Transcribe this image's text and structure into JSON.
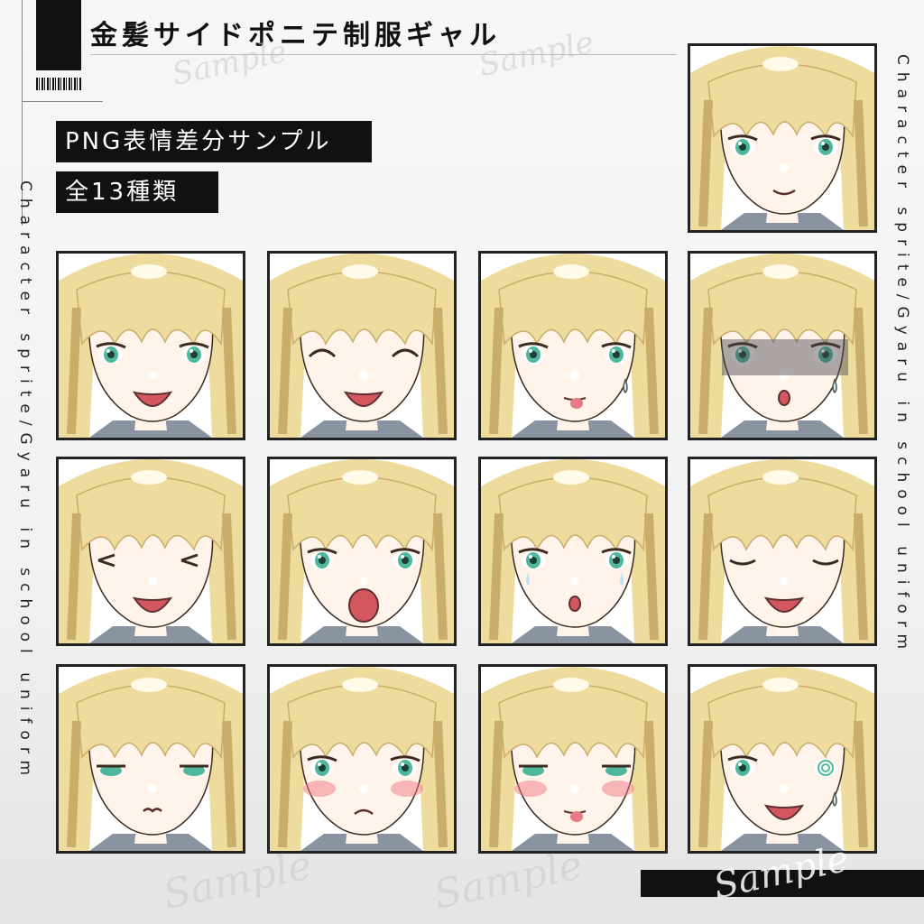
{
  "header": {
    "title": "金髪サイドポニテ制服ギャル",
    "tag_line1": "PNG表情差分サンプル",
    "tag_line2": "全13種類"
  },
  "side_text": {
    "left": "Character sprite/Gyaru in school uniform",
    "right": "Character sprite/Gyaru in school uniform"
  },
  "watermark": "Sample",
  "colors": {
    "hair": "#eedb9e",
    "hair_shadow": "#c9ad6b",
    "skin": "#fff3ea",
    "eye": "#4fb89c",
    "mouth": "#d4565f",
    "shirt": "#8a94a0",
    "frame": "#222222"
  },
  "expressions": [
    {
      "eyes": "open",
      "mouth": "smile-closed",
      "blush": false,
      "extra": "none"
    },
    {
      "eyes": "open",
      "mouth": "open-happy",
      "blush": false,
      "extra": "none"
    },
    {
      "eyes": "closed-happy",
      "mouth": "open-happy",
      "blush": false,
      "extra": "none"
    },
    {
      "eyes": "open",
      "mouth": "tongue",
      "blush": false,
      "extra": "sweat"
    },
    {
      "eyes": "open",
      "mouth": "small-o",
      "blush": false,
      "extra": "shadow-sweat"
    },
    {
      "eyes": "wink",
      "mouth": "open-happy",
      "blush": false,
      "extra": "none"
    },
    {
      "eyes": "open",
      "mouth": "shout",
      "blush": false,
      "extra": "none"
    },
    {
      "eyes": "open",
      "mouth": "small-o",
      "blush": false,
      "extra": "tears"
    },
    {
      "eyes": "closed-calm",
      "mouth": "open-happy",
      "blush": false,
      "extra": "none"
    },
    {
      "eyes": "half",
      "mouth": "pout",
      "blush": false,
      "extra": "none"
    },
    {
      "eyes": "open",
      "mouth": "frown",
      "blush": true,
      "extra": "none"
    },
    {
      "eyes": "half",
      "mouth": "tongue",
      "blush": true,
      "extra": "none"
    },
    {
      "eyes": "spiral",
      "mouth": "open-happy",
      "blush": false,
      "extra": "sweat"
    }
  ]
}
